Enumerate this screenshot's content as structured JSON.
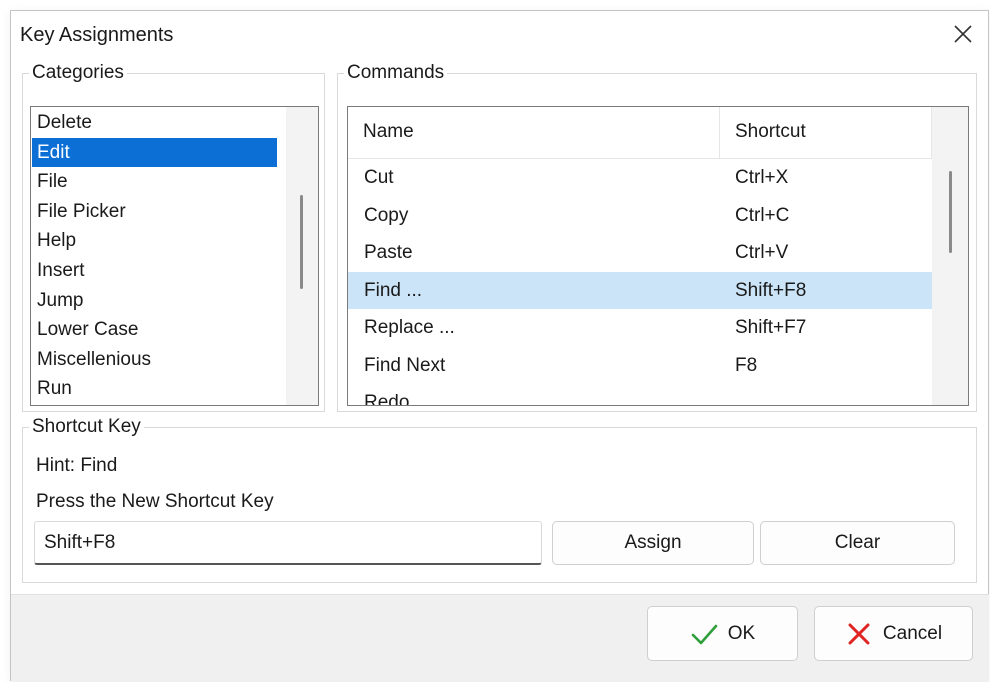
{
  "window": {
    "title": "Key Assignments"
  },
  "categories": {
    "label": "Categories",
    "items": [
      "Delete",
      "Edit",
      "File",
      "File Picker",
      "Help",
      "Insert",
      "Jump",
      "Lower Case",
      "Miscellenious",
      "Run"
    ],
    "selected_index": 1
  },
  "commands": {
    "label": "Commands",
    "columns": {
      "name": "Name",
      "shortcut": "Shortcut"
    },
    "rows": [
      {
        "name": "Cut",
        "shortcut": "Ctrl+X"
      },
      {
        "name": "Copy",
        "shortcut": "Ctrl+C"
      },
      {
        "name": "Paste",
        "shortcut": "Ctrl+V"
      },
      {
        "name": "Find ...",
        "shortcut": "Shift+F8"
      },
      {
        "name": "Replace ...",
        "shortcut": "Shift+F7"
      },
      {
        "name": "Find Next",
        "shortcut": "F8"
      },
      {
        "name": "Redo",
        "shortcut": ""
      }
    ],
    "selected_index": 3
  },
  "shortcut_key": {
    "label": "Shortcut Key",
    "hint": "Hint: Find",
    "prompt": "Press the New Shortcut Key",
    "value": "Shift+F8",
    "assign_label": "Assign",
    "clear_label": "Clear"
  },
  "footer": {
    "ok_label": "OK",
    "cancel_label": "Cancel"
  },
  "icons": {
    "close": "close-icon",
    "ok": "checkmark-icon",
    "cancel": "x-mark-icon"
  },
  "colors": {
    "category_selection": "#0b6fd6",
    "command_selection": "#cce4f7",
    "ok_check": "#2e9e3a",
    "cancel_x": "#e02424"
  }
}
